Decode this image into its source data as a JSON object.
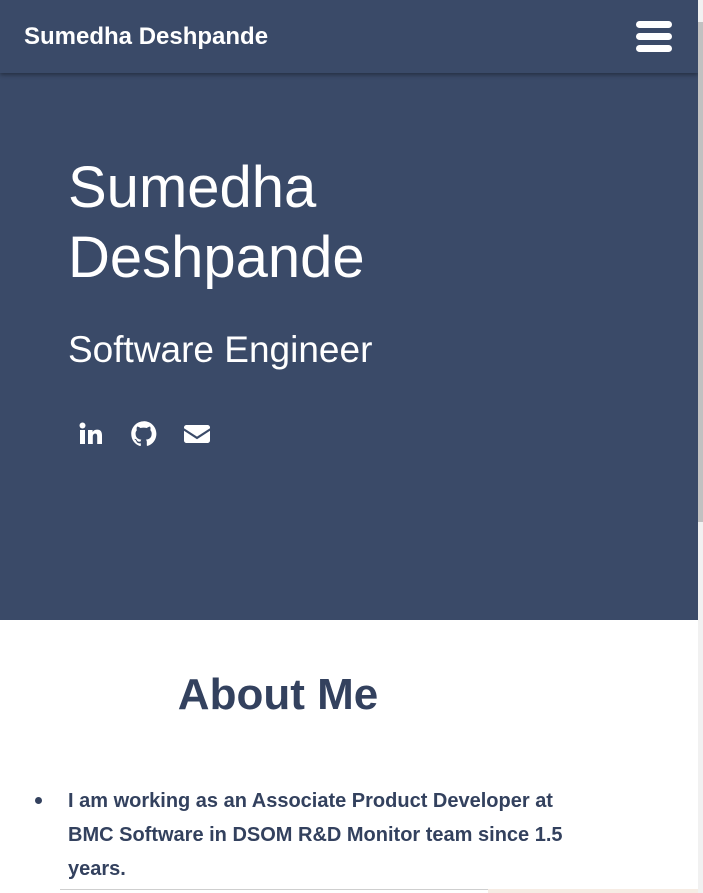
{
  "navbar": {
    "brand": "Sumedha Deshpande",
    "menu_icon": "hamburger-menu-icon"
  },
  "hero": {
    "name_line1": "Sumedha",
    "name_line2": "Deshpande",
    "title": "Software Engineer",
    "social_links": [
      {
        "icon": "linkedin-icon"
      },
      {
        "icon": "github-icon"
      },
      {
        "icon": "envelope-icon"
      }
    ]
  },
  "about": {
    "heading": "About Me",
    "items": [
      "I am working as an Associate Product Developer at BMC Software in DSOM R&D Monitor team since 1.5 years."
    ]
  },
  "colors": {
    "primary_navy": "#3a4a68",
    "heading_text": "#33415e",
    "white": "#ffffff"
  }
}
